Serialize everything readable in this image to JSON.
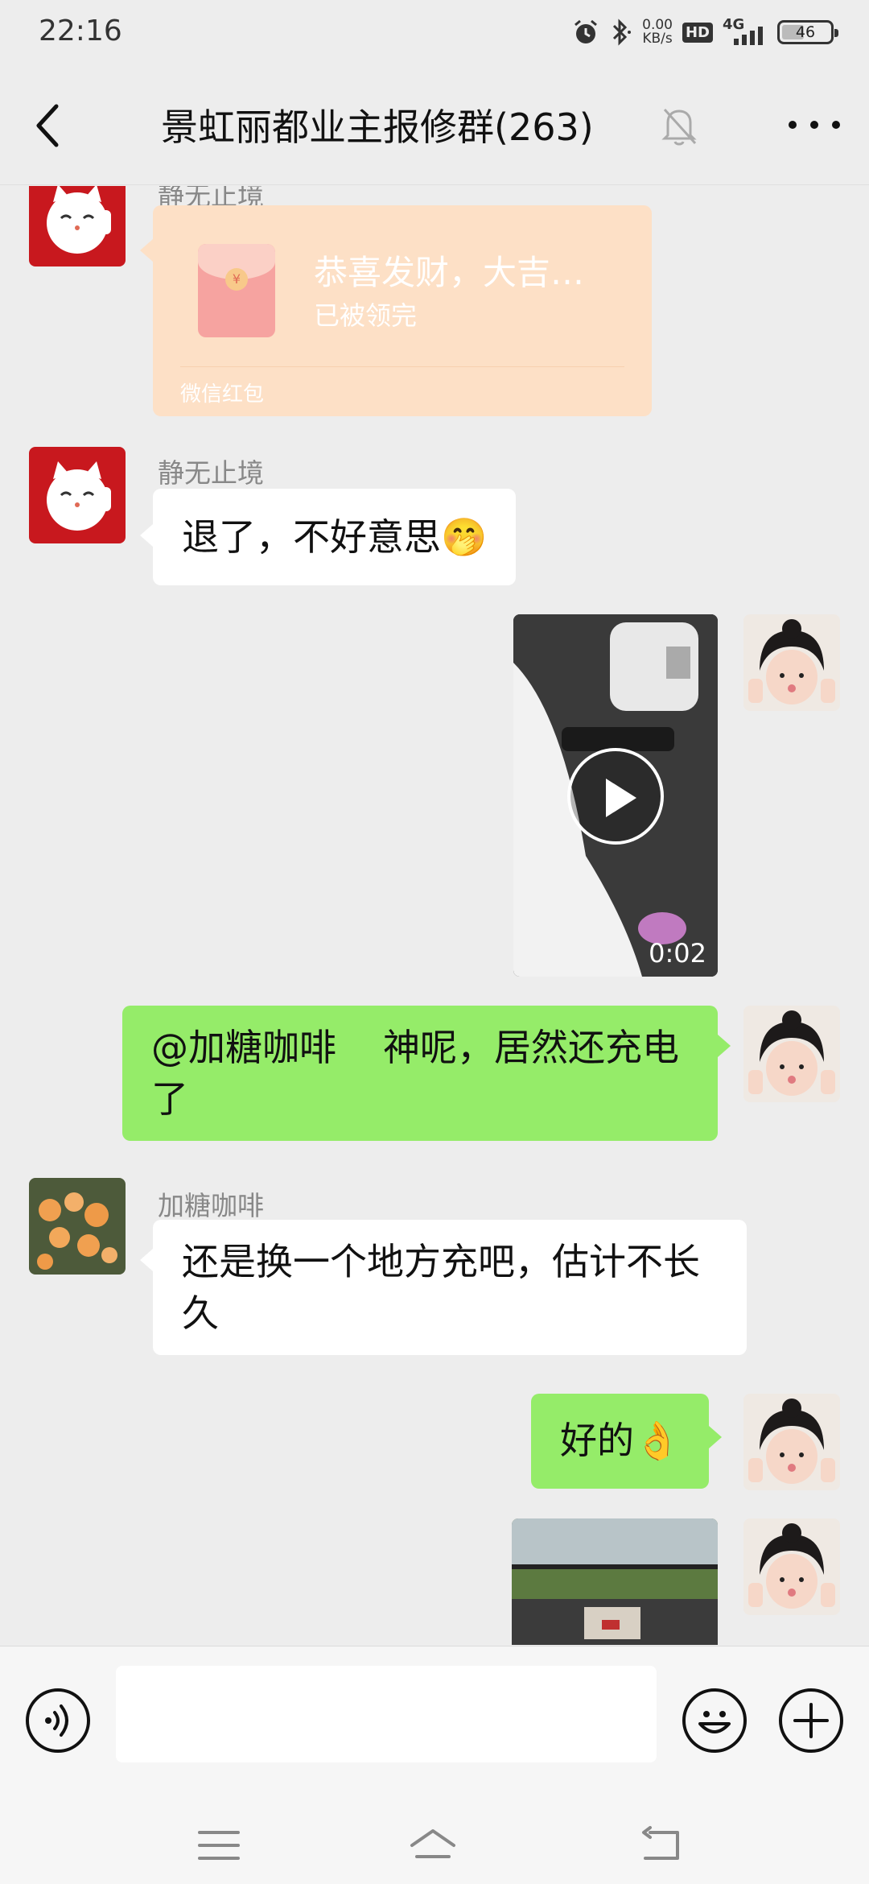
{
  "status_bar": {
    "time": "22:16",
    "net_speed_value": "0.00",
    "net_speed_unit": "KB/s",
    "hd": "HD",
    "signal": "4G",
    "battery_percent": "46",
    "battery_level": 0.46,
    "icons": [
      "alarm-icon",
      "bluetooth-icon"
    ]
  },
  "header": {
    "title": "景虹丽都业主报修群(263)",
    "icons": [
      "back-icon",
      "mute-bell-icon",
      "more-icon"
    ]
  },
  "messages": [
    {
      "type": "red_packet",
      "sender": "静无止境",
      "title": "恭喜发财，大吉…",
      "status": "已被领完",
      "footer": "微信红包"
    },
    {
      "type": "text",
      "sender": "静无止境",
      "text": "退了，不好意思",
      "emoji": "🤭"
    },
    {
      "type": "video",
      "from_self": true,
      "duration": "0:02"
    },
    {
      "type": "text",
      "from_self": true,
      "mention": "@加糖咖啡",
      "text": "神呢，居然还充电了"
    },
    {
      "type": "text",
      "sender": "加糖咖啡",
      "text": "还是换一个地方充吧，估计不长久"
    },
    {
      "type": "text",
      "from_self": true,
      "text": "好的",
      "emoji": "👌"
    },
    {
      "type": "image",
      "from_self": true
    }
  ],
  "input_bar": {
    "placeholder": "",
    "icons": [
      "voice-icon",
      "emoji-icon",
      "plus-icon"
    ]
  },
  "nav_bar": {
    "icons": [
      "menu-icon",
      "home-icon",
      "back-nav-icon"
    ]
  },
  "colors": {
    "background": "#ededed",
    "self_bubble": "#95ec69",
    "other_bubble": "#ffffff",
    "red_packet_faded": "#fde0c6"
  }
}
